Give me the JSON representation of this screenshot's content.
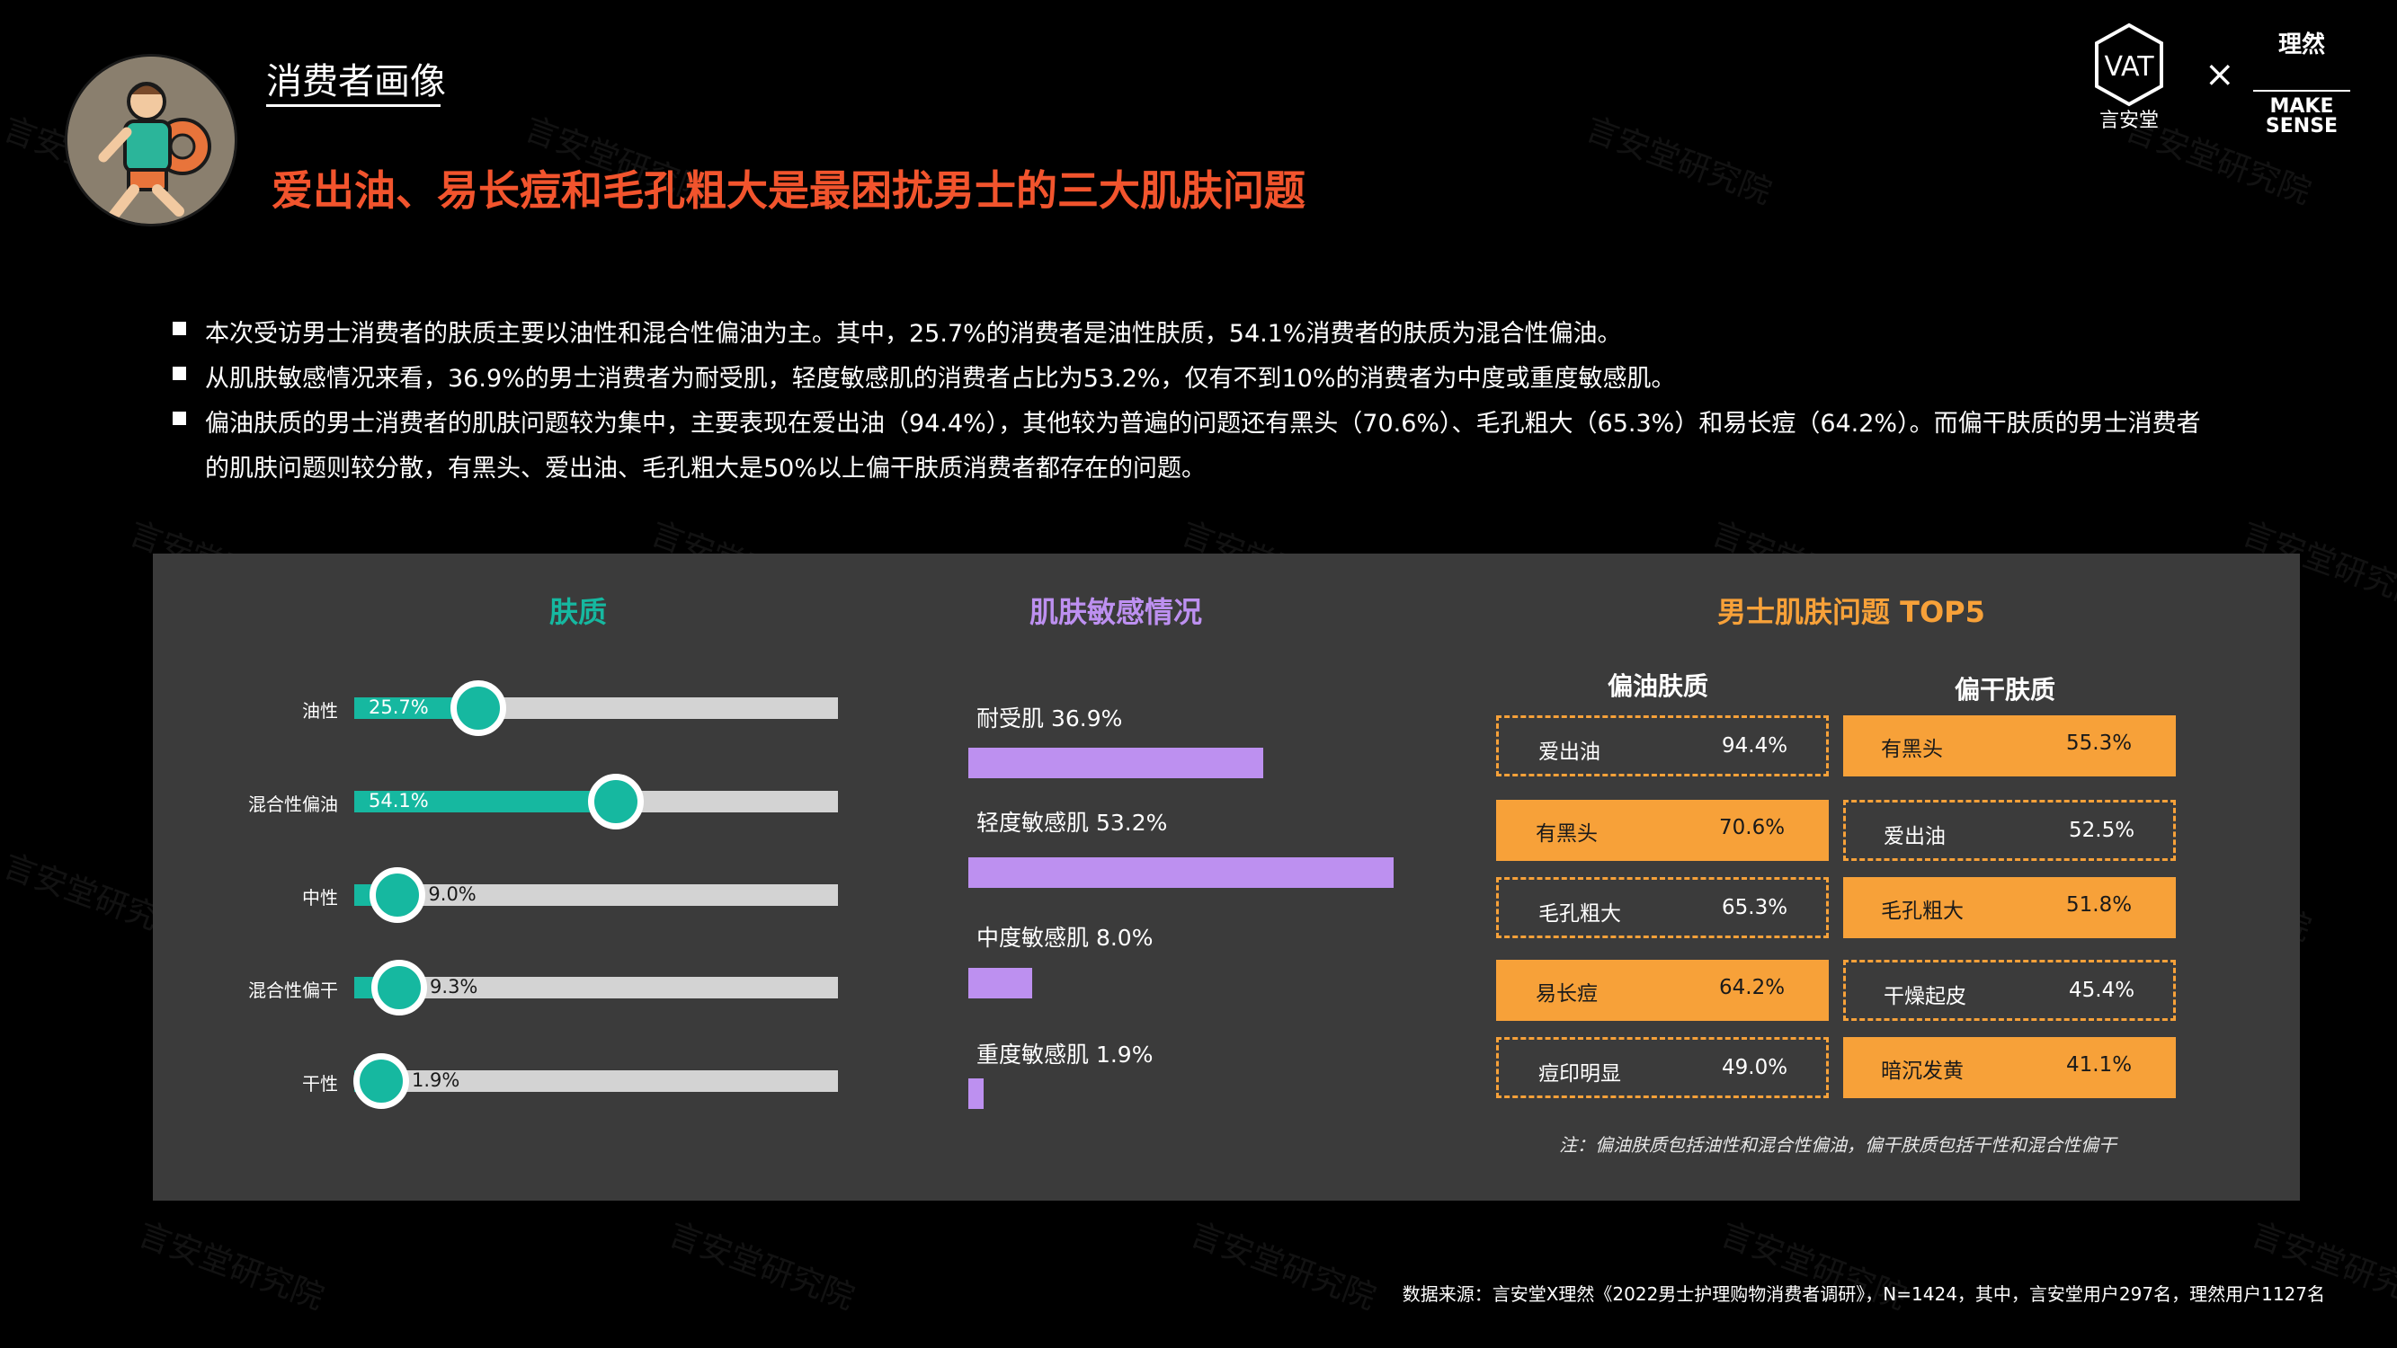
{
  "header": {
    "section_label": "消费者画像",
    "headline": "爱出油、易长痘和毛孔粗大是最困扰男士的三大肌肤问题"
  },
  "logos": {
    "brand1_text": "言安堂",
    "separator": "×",
    "brand2_cn": "理然",
    "brand2_en_1": "MAKE",
    "brand2_en_2": "SENSE"
  },
  "watermark": "言安堂研究院",
  "bullets": [
    "本次受访男士消费者的肤质主要以油性和混合性偏油为主。其中，25.7%的消费者是油性肤质，54.1%消费者的肤质为混合性偏油。",
    "从肌肤敏感情况来看，36.9%的男士消费者为耐受肌，轻度敏感肌的消费者占比为53.2%，仅有不到10%的消费者为中度或重度敏感肌。",
    "偏油肤质的男士消费者的肌肤问题较为集中，主要表现在爱出油（94.4%），其他较为普遍的问题还有黑头（70.6%）、毛孔粗大（65.3%）和易长痘（64.2%）。而偏干肤质的男士消费者",
    "的肌肤问题则较分散，有黑头、爱出油、毛孔粗大是50%以上偏干肤质消费者都存在的问题。"
  ],
  "colors": {
    "teal": "#16b8a0",
    "purple": "#bd90f0",
    "orange": "#f7a139",
    "headline_red": "#f2542d",
    "panel_bg": "#3b3b3b"
  },
  "chart_data": [
    {
      "type": "bar",
      "title": "肤质",
      "categories": [
        "油性",
        "混合性偏油",
        "中性",
        "混合性偏干",
        "干性"
      ],
      "values": [
        25.7,
        54.1,
        9.0,
        9.3,
        1.9
      ],
      "value_labels": [
        "25.7%",
        "54.1%",
        "9.0%",
        "9.3%",
        "1.9%"
      ],
      "ylim": [
        0,
        100
      ]
    },
    {
      "type": "bar",
      "title": "肌肤敏感情况",
      "categories": [
        "耐受肌",
        "轻度敏感肌",
        "中度敏感肌",
        "重度敏感肌"
      ],
      "values": [
        36.9,
        53.2,
        8.0,
        1.9
      ],
      "value_labels": [
        "36.9%",
        "53.2%",
        "8.0%",
        "1.9%"
      ]
    },
    {
      "type": "table",
      "title": "男士肌肤问题 TOP5",
      "columns": [
        "偏油肤质",
        "偏干肤质"
      ],
      "oily": [
        {
          "name": "爱出油",
          "value": "94.4%",
          "highlight": false
        },
        {
          "name": "有黑头",
          "value": "70.6%",
          "highlight": true
        },
        {
          "name": "毛孔粗大",
          "value": "65.3%",
          "highlight": false
        },
        {
          "name": "易长痘",
          "value": "64.2%",
          "highlight": true
        },
        {
          "name": "痘印明显",
          "value": "49.0%",
          "highlight": false
        }
      ],
      "dry": [
        {
          "name": "有黑头",
          "value": "55.3%",
          "highlight": true
        },
        {
          "name": "爱出油",
          "value": "52.5%",
          "highlight": false
        },
        {
          "name": "毛孔粗大",
          "value": "51.8%",
          "highlight": true
        },
        {
          "name": "干燥起皮",
          "value": "45.4%",
          "highlight": false
        },
        {
          "name": "暗沉发黄",
          "value": "41.1%",
          "highlight": true
        }
      ],
      "note": "注：偏油肤质包括油性和混合性偏油，偏干肤质包括干性和混合性偏干"
    }
  ],
  "source": "数据来源：言安堂X理然《2022男士护理购物消费者调研》，N=1424，其中，言安堂用户297名，理然用户1127名"
}
